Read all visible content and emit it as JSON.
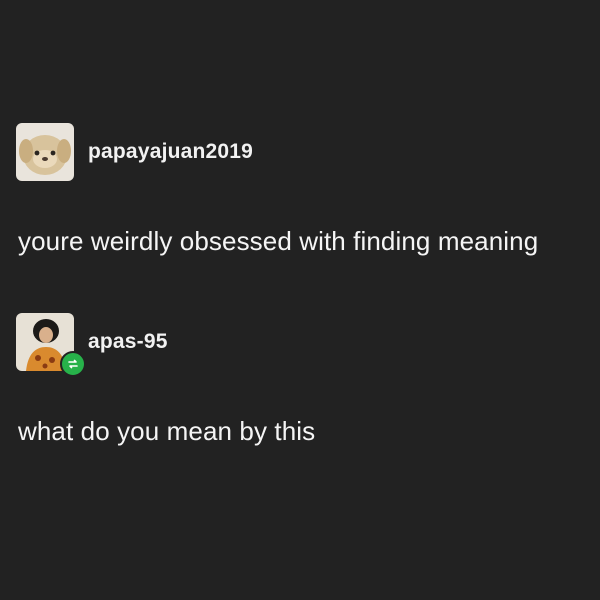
{
  "posts": [
    {
      "username": "papayajuan2019",
      "avatar_icon": "plush-dog-avatar",
      "text": "youre weirdly obsessed with finding meaning"
    },
    {
      "username": "apas-95",
      "avatar_icon": "person-avatar",
      "badge_icon": "reblog-icon",
      "text": "what do you mean by this"
    }
  ],
  "colors": {
    "background": "#222222",
    "text": "#f5f5f5",
    "reblog_badge": "#27b24a"
  }
}
